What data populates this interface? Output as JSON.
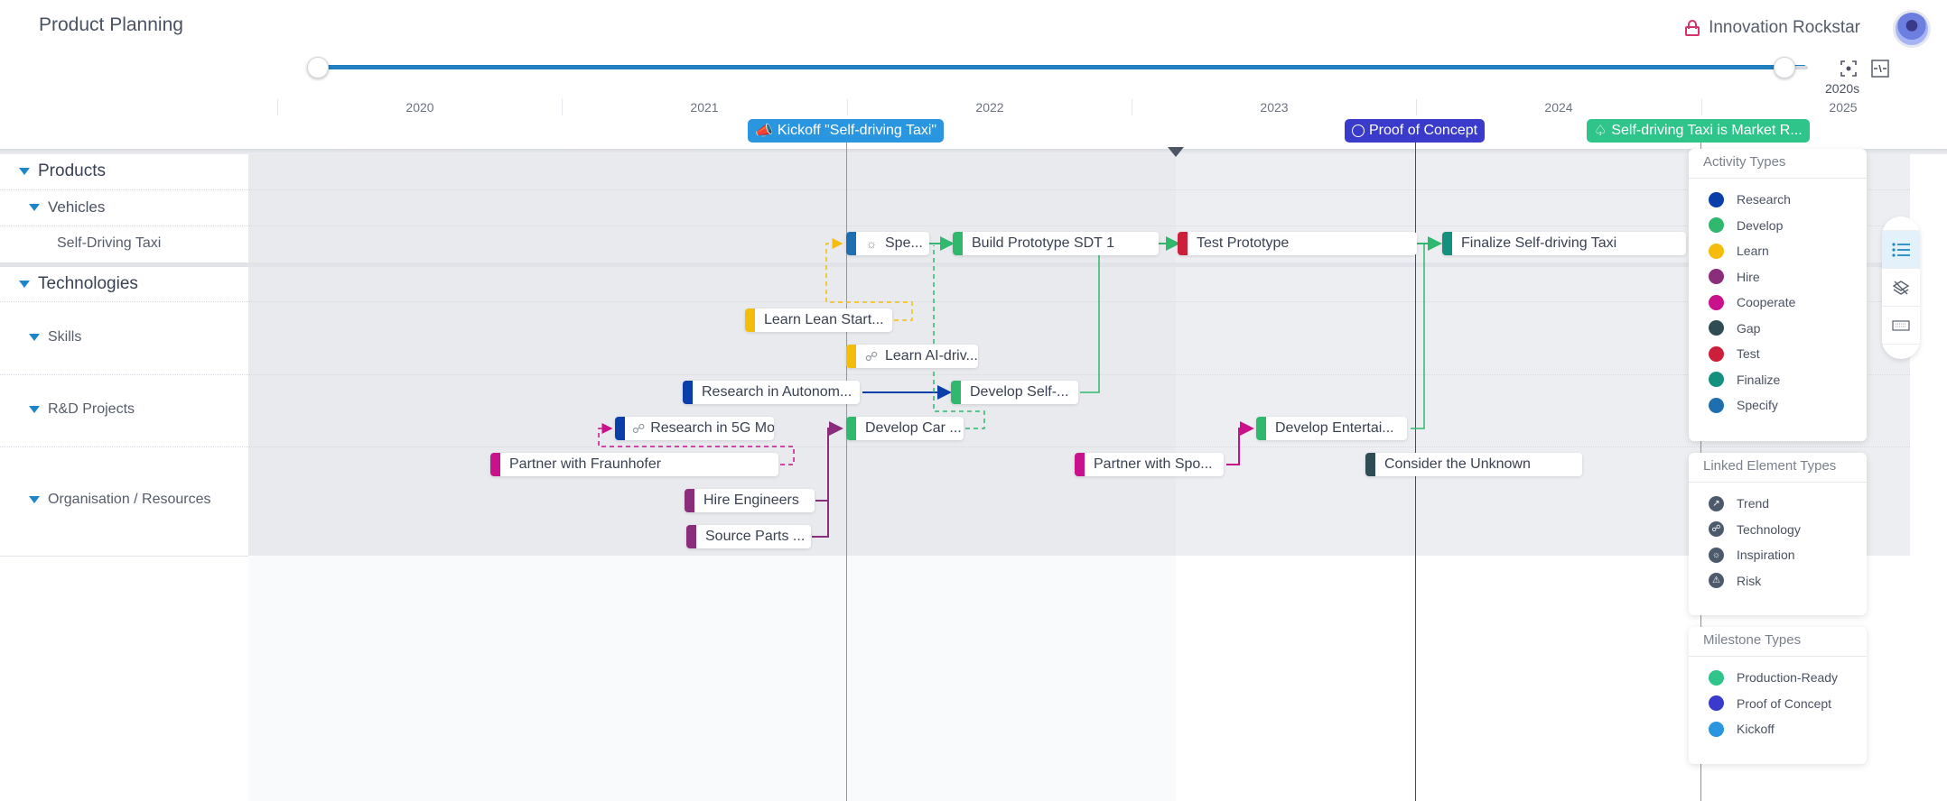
{
  "header": {
    "title": "Product Planning",
    "user_name": "Innovation Rockstar"
  },
  "timeline": {
    "zoom_level_label": "2020s",
    "years": [
      "2020",
      "2021",
      "2022",
      "2023",
      "2024",
      "2025"
    ],
    "range_slider": {
      "start_fraction": 0.0,
      "end_fraction": 0.985
    }
  },
  "milestones": [
    {
      "label": "Kickoff \"Self-driving Taxi\"",
      "type": "Kickoff",
      "color": "#2a96df"
    },
    {
      "label": "Proof of Concept",
      "type": "Proof of Concept",
      "color": "#3a3acb"
    },
    {
      "label": "Self-driving Taxi is Market R...",
      "type": "Production-Ready",
      "color": "#2fc58a"
    }
  ],
  "tree": [
    {
      "label": "Products",
      "level": 0,
      "expanded": true
    },
    {
      "label": "Vehicles",
      "level": 1,
      "expanded": true
    },
    {
      "label": "Self-Driving Taxi",
      "level": 2
    },
    {
      "label": "Technologies",
      "level": 0,
      "expanded": true
    },
    {
      "label": "Skills",
      "level": 1,
      "expanded": true
    },
    {
      "label": "R&D Projects",
      "level": 1,
      "expanded": true
    },
    {
      "label": "Organisation / Resources",
      "level": 1,
      "expanded": true
    }
  ],
  "activities": [
    {
      "label": "Spe...",
      "type": "Specify",
      "color": "#1f6fb0",
      "linked": "Inspiration",
      "row": "Self-Driving Taxi"
    },
    {
      "label": "Build Prototype SDT 1",
      "type": "Develop",
      "color": "#2fb86e",
      "row": "Self-Driving Taxi"
    },
    {
      "label": "Test Prototype",
      "type": "Test",
      "color": "#cc1f3c",
      "row": "Self-Driving Taxi"
    },
    {
      "label": "Finalize Self-driving Taxi",
      "type": "Finalize",
      "color": "#14917e",
      "row": "Self-Driving Taxi"
    },
    {
      "label": "Learn Lean Start...",
      "type": "Learn",
      "color": "#f5bd0b",
      "row": "Skills"
    },
    {
      "label": "Learn AI-driv...",
      "type": "Learn",
      "color": "#f5bd0b",
      "linked": "Technology",
      "row": "Skills"
    },
    {
      "label": "Research in Autonom...",
      "type": "Research",
      "color": "#0a3ea8",
      "row": "R&D Projects"
    },
    {
      "label": "Develop Self-...",
      "type": "Develop",
      "color": "#2fb86e",
      "row": "R&D Projects"
    },
    {
      "label": "Research in 5G Mo...",
      "type": "Research",
      "color": "#0a3ea8",
      "linked": "Technology",
      "row": "R&D Projects"
    },
    {
      "label": "Develop Car ...",
      "type": "Develop",
      "color": "#2fb86e",
      "row": "R&D Projects"
    },
    {
      "label": "Develop Entertai...",
      "type": "Develop",
      "color": "#2fb86e",
      "row": "R&D Projects"
    },
    {
      "label": "Partner with Fraunhofer",
      "type": "Cooperate",
      "color": "#c8118a",
      "row": "Organisation / Resources"
    },
    {
      "label": "Partner with Spo...",
      "type": "Cooperate",
      "color": "#c8118a",
      "row": "Organisation / Resources"
    },
    {
      "label": "Consider the Unknown",
      "type": "Gap",
      "color": "#2f4c55",
      "row": "Organisation / Resources"
    },
    {
      "label": "Hire Engineers",
      "type": "Hire",
      "color": "#8a2e7c",
      "row": "Organisation / Resources"
    },
    {
      "label": "Source Parts ...",
      "type": "Hire",
      "color": "#8a2e7c",
      "row": "Organisation / Resources"
    }
  ],
  "legend": {
    "activity_types": {
      "title": "Activity Types",
      "items": [
        {
          "label": "Research",
          "color": "#0a3ea8"
        },
        {
          "label": "Develop",
          "color": "#2fb86e"
        },
        {
          "label": "Learn",
          "color": "#f5bd0b"
        },
        {
          "label": "Hire",
          "color": "#8a2e7c"
        },
        {
          "label": "Cooperate",
          "color": "#c8118a"
        },
        {
          "label": "Gap",
          "color": "#2f4c55"
        },
        {
          "label": "Test",
          "color": "#cc1f3c"
        },
        {
          "label": "Finalize",
          "color": "#14917e"
        },
        {
          "label": "Specify",
          "color": "#1f6fb0"
        }
      ]
    },
    "linked_element_types": {
      "title": "Linked Element Types",
      "items": [
        {
          "label": "Trend",
          "icon": "trend-icon"
        },
        {
          "label": "Technology",
          "icon": "technology-icon"
        },
        {
          "label": "Inspiration",
          "icon": "inspiration-icon"
        },
        {
          "label": "Risk",
          "icon": "risk-icon"
        }
      ]
    },
    "milestone_types": {
      "title": "Milestone Types",
      "items": [
        {
          "label": "Production-Ready",
          "color": "#2fc58a"
        },
        {
          "label": "Proof of Concept",
          "color": "#3a3acb"
        },
        {
          "label": "Kickoff",
          "color": "#2a96df"
        }
      ]
    }
  },
  "side_toolbar": [
    "legend-toggle",
    "layers-toggle",
    "keyboard-shortcuts"
  ]
}
